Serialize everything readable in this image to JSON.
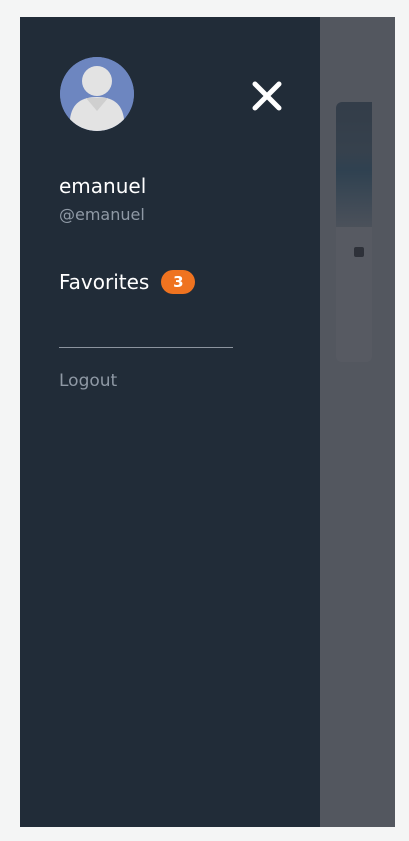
{
  "drawer": {
    "user": {
      "name": "emanuel",
      "handle": "@emanuel",
      "avatar_icon": "user-avatar-icon"
    },
    "close_icon": "close-icon",
    "menu": {
      "favorites_label": "Favorites",
      "favorites_count": "3",
      "logout_label": "Logout"
    }
  },
  "colors": {
    "drawer_bg": "#212c38",
    "badge": "#ef7320",
    "avatar_bg": "#6d86c0",
    "overlay": "#5a5e68"
  }
}
